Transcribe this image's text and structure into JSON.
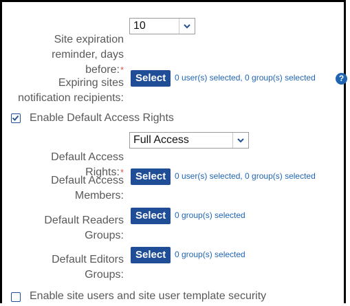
{
  "expiration": {
    "label_lines": "Site expiration\nreminder, days\nbefore:",
    "required_mark": "*",
    "value": "10"
  },
  "recipients": {
    "label_lines": "Expiring sites\nnotification recipients:",
    "button": "Select",
    "summary": "0 user(s) selected, 0 group(s) selected",
    "help_icon": "?"
  },
  "default_access": {
    "checkbox_label": "Enable Default Access Rights",
    "checked": true,
    "rights_label": "Default Access\nRights:",
    "rights_required_mark": "*",
    "rights_value": "Full Access",
    "members_label": "Default Access\nMembers:",
    "members_button": "Select",
    "members_summary": "0 user(s) selected, 0 group(s) selected",
    "readers_label": "Default Readers\nGroups:",
    "readers_button": "Select",
    "readers_summary": "0 group(s) selected",
    "editors_label": "Default Editors\nGroups:",
    "editors_button": "Select",
    "editors_summary": "0 group(s) selected"
  },
  "site_users": {
    "checkbox_label": "Enable site users and site user template security",
    "checked": false
  },
  "colors": {
    "button": "#1f4e96",
    "link": "#1f64b2",
    "required": "#d9534f",
    "label": "#595959"
  }
}
